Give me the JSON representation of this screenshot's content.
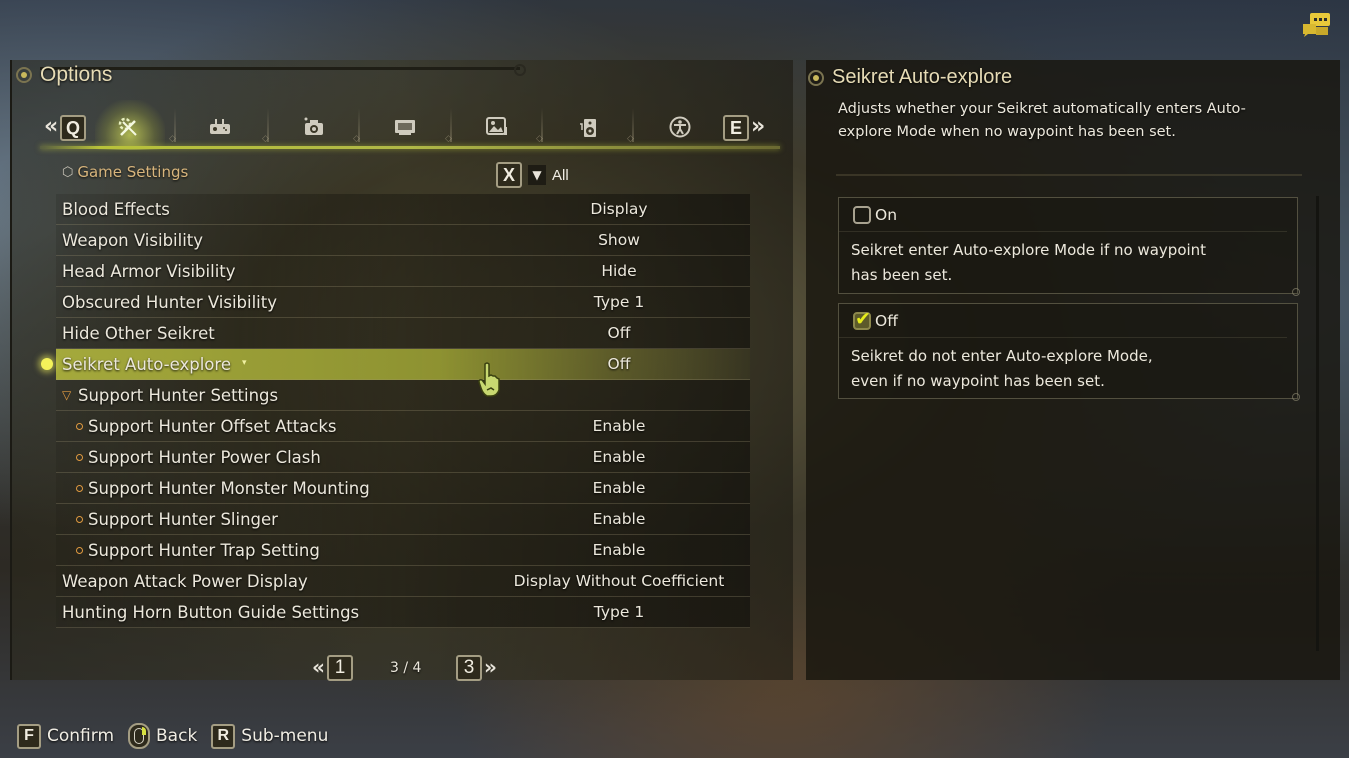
{
  "header": {
    "title": "Options"
  },
  "tabs": {
    "prev_key": "Q",
    "next_key": "E",
    "prev_chevron": "«",
    "next_chevron": "»",
    "items": [
      {
        "icon": "wrench-gear-icon",
        "glyph": "⚒",
        "active": true
      },
      {
        "icon": "controller-icon",
        "glyph": "🎮",
        "active": false
      },
      {
        "icon": "camera-icon",
        "glyph": "📷",
        "active": false
      },
      {
        "icon": "monitor-icon",
        "glyph": "🖥",
        "active": false
      },
      {
        "icon": "image-icon",
        "glyph": "🖼",
        "active": false
      },
      {
        "icon": "speaker-icon",
        "glyph": "🔊",
        "active": false
      },
      {
        "icon": "accessibility-icon",
        "glyph": "♿",
        "active": false
      }
    ]
  },
  "section": {
    "title": "Game Settings",
    "filter_key": "X",
    "filter_label": "All"
  },
  "settings": [
    {
      "label": "Blood Effects",
      "value": "Display",
      "type": "normal"
    },
    {
      "label": "Weapon Visibility",
      "value": "Show",
      "type": "normal"
    },
    {
      "label": "Head Armor Visibility",
      "value": "Hide",
      "type": "normal"
    },
    {
      "label": "Obscured Hunter Visibility",
      "value": "Type 1",
      "type": "normal"
    },
    {
      "label": "Hide Other Seikret",
      "value": "Off",
      "type": "normal"
    },
    {
      "label": "Seikret Auto-explore",
      "value": "Off",
      "type": "selected"
    },
    {
      "label": "Support Hunter Settings",
      "value": "",
      "type": "group"
    },
    {
      "label": "Support Hunter Offset Attacks",
      "value": "Enable",
      "type": "sub"
    },
    {
      "label": "Support Hunter Power Clash",
      "value": "Enable",
      "type": "sub"
    },
    {
      "label": "Support Hunter Monster Mounting",
      "value": "Enable",
      "type": "sub"
    },
    {
      "label": "Support Hunter Slinger",
      "value": "Enable",
      "type": "sub"
    },
    {
      "label": "Support Hunter Trap Setting",
      "value": "Enable",
      "type": "sub"
    },
    {
      "label": "Weapon Attack Power Display",
      "value": "Display Without Coefficient",
      "type": "normal"
    },
    {
      "label": "Hunting Horn Button Guide Settings",
      "value": "Type 1",
      "type": "normal"
    }
  ],
  "pagination": {
    "prev_key": "1",
    "next_key": "3",
    "current": "3 / 4",
    "prev_chevron": "«",
    "next_chevron": "»"
  },
  "footer": {
    "confirm_key": "F",
    "confirm_label": "Confirm",
    "back_label": "Back",
    "submenu_key": "R",
    "submenu_label": "Sub-menu"
  },
  "detail": {
    "title": "Seikret Auto-explore",
    "description": "Adjusts whether your Seikret automatically enters Auto-explore Mode when no waypoint has been set.",
    "options": [
      {
        "name": "On",
        "checked": false,
        "desc_line1": "Seikret enter Auto-explore Mode if no waypoint",
        "desc_line2": "has been set."
      },
      {
        "name": "Off",
        "checked": true,
        "desc_line1": "Seikret do not enter Auto-explore Mode,",
        "desc_line2": "even if no waypoint has been set."
      }
    ]
  },
  "colors": {
    "accent": "#c8d040",
    "section_title": "#d8b57c",
    "bullet": "#e09a40",
    "chat_icon": "#e8c83a"
  }
}
